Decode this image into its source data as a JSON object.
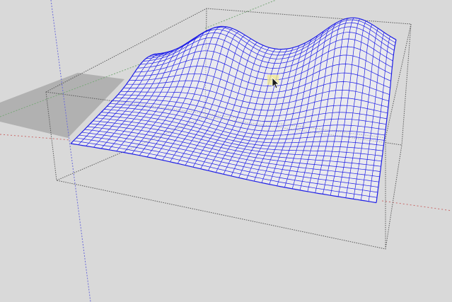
{
  "viewport": {
    "tool": "select",
    "colors": {
      "background": "#d9d9d9",
      "mesh_lines": "#1f1fe6",
      "mesh_fill": "#f7f7ff",
      "bounding_box": "#5a5a5a",
      "axis_red": "#c96b6b",
      "axis_green": "#7aa87a",
      "axis_blue": "#6b6bd9",
      "ground_shadow": "#a8a8a8",
      "cursor_highlight": "#f2e88c"
    },
    "mesh": {
      "rows": 30,
      "cols": 40,
      "shape": "smooth wavy terrain surface with two hills along the far edge"
    },
    "icons": [
      "select-arrow-icon"
    ]
  }
}
